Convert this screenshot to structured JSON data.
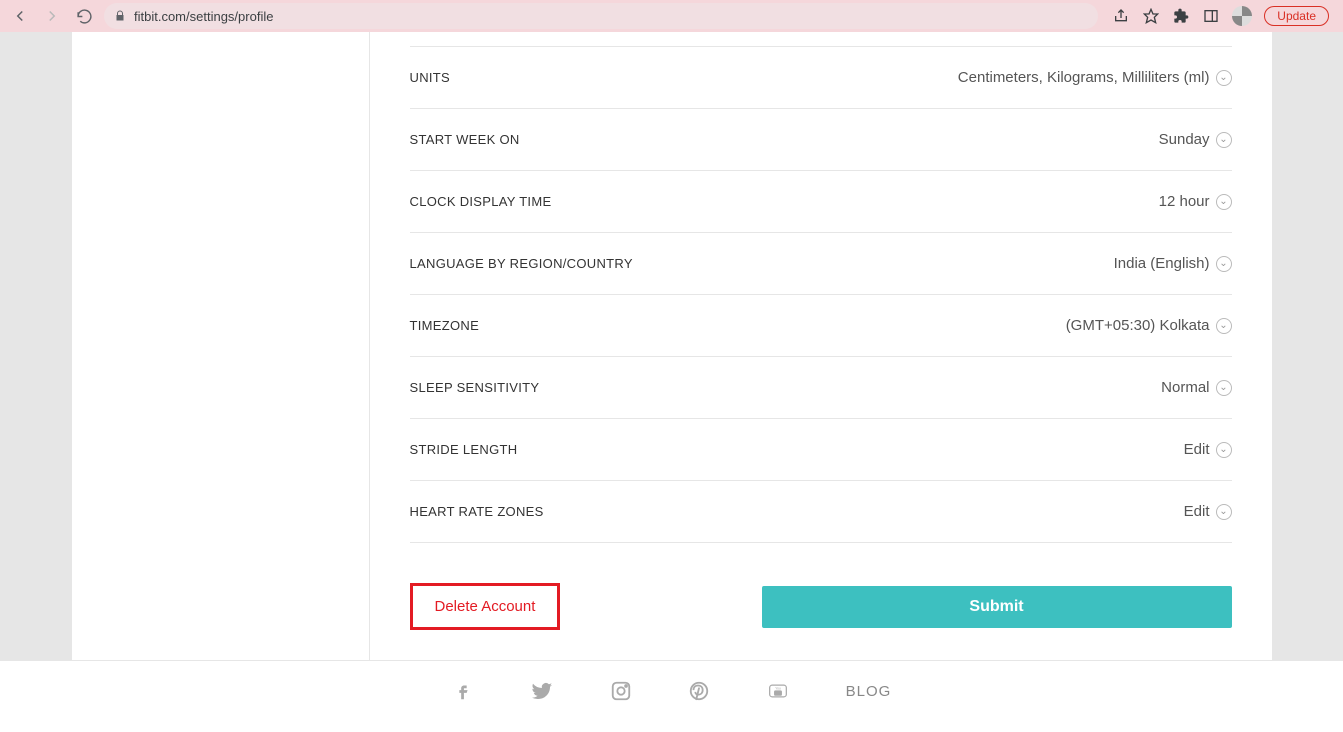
{
  "browser": {
    "url": "fitbit.com/settings/profile",
    "update_label": "Update"
  },
  "settings": {
    "units": {
      "label": "UNITS",
      "value": "Centimeters, Kilograms, Milliliters (ml)"
    },
    "start_week": {
      "label": "START WEEK ON",
      "value": "Sunday"
    },
    "clock": {
      "label": "CLOCK DISPLAY TIME",
      "value": "12 hour"
    },
    "language": {
      "label": "LANGUAGE BY REGION/COUNTRY",
      "value": "India (English)"
    },
    "timezone": {
      "label": "TIMEZONE",
      "value": "(GMT+05:30) Kolkata"
    },
    "sleep": {
      "label": "SLEEP SENSITIVITY",
      "value": "Normal"
    },
    "stride": {
      "label": "STRIDE LENGTH",
      "value": "Edit"
    },
    "heart": {
      "label": "HEART RATE ZONES",
      "value": "Edit"
    }
  },
  "buttons": {
    "delete": "Delete Account",
    "submit": "Submit"
  },
  "footer": {
    "blog": "BLOG"
  }
}
